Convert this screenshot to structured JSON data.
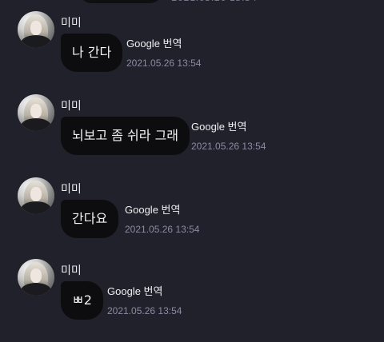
{
  "colors": {
    "background": "#21212b",
    "bubble": "#0d0d10",
    "text": "#f2f2f4",
    "timestamp": "#8b8ba2"
  },
  "messages": [
    {
      "sender": "미미",
      "text": "나 간다",
      "translate_label": "Google 번역",
      "timestamp": "2021.05.26 13:54",
      "avatar_icon": "profile-avatar"
    },
    {
      "sender": "미미",
      "text": "뇌보고 좀 쉬라 그래",
      "translate_label": "Google 번역",
      "timestamp": "2021.05.26 13:54",
      "avatar_icon": "profile-avatar"
    },
    {
      "sender": "미미",
      "text": "간다요",
      "translate_label": "Google 번역",
      "timestamp": "2021.05.26 13:54",
      "avatar_icon": "profile-avatar"
    },
    {
      "sender": "미미",
      "text": "ㅃ2",
      "translate_label": "Google 번역",
      "timestamp": "2021.05.26 13:54",
      "avatar_icon": "profile-avatar"
    }
  ]
}
